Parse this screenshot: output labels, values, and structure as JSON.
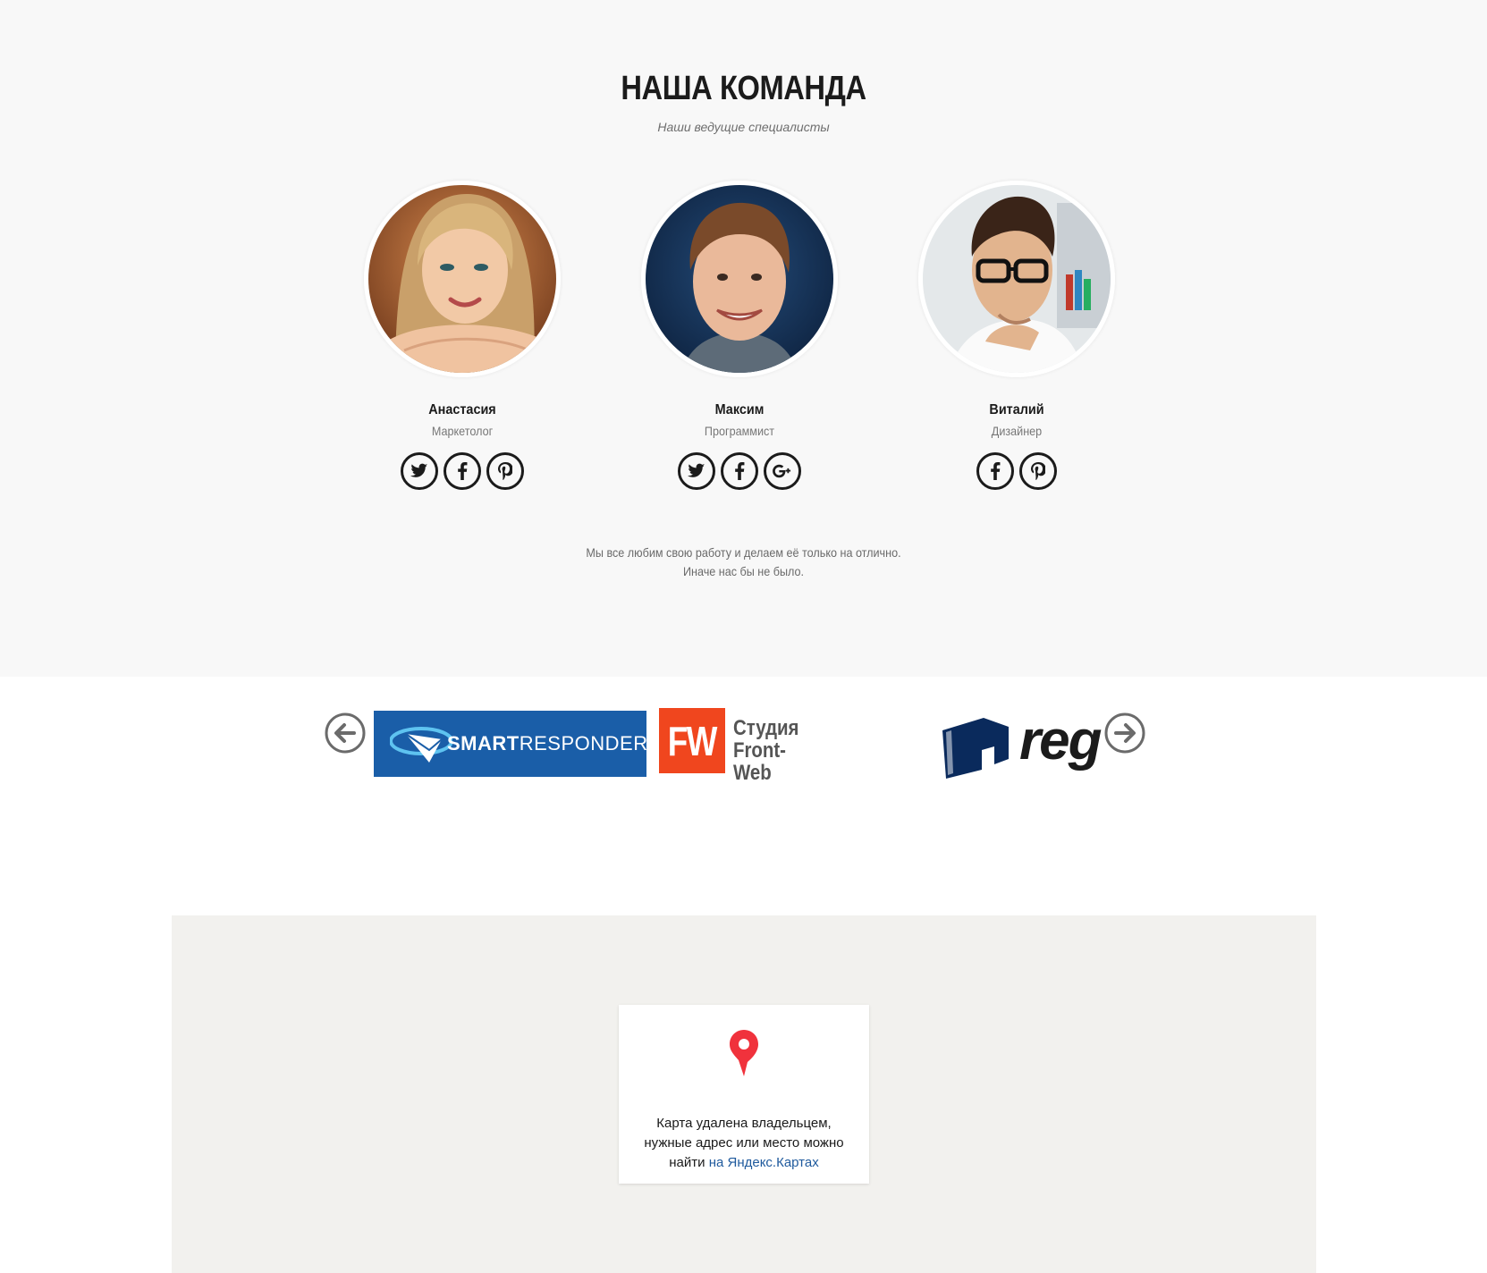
{
  "team": {
    "title": "НАША КОМАНДА",
    "subtitle": "Наши ведущие специалисты",
    "members": [
      {
        "name": "Анастасия",
        "role": "Маркетолог",
        "socials": [
          "twitter-icon",
          "facebook-icon",
          "pinterest-icon"
        ]
      },
      {
        "name": "Максим",
        "role": "Программист",
        "socials": [
          "twitter-icon",
          "facebook-icon",
          "google-plus-icon"
        ]
      },
      {
        "name": "Виталий",
        "role": "Дизайнер",
        "socials": [
          "facebook-icon",
          "pinterest-icon"
        ]
      }
    ],
    "note_line1": "Мы все любим свою работу и делаем её только на отлично.",
    "note_line2": "Иначе нас бы не было."
  },
  "partners": {
    "logos": [
      {
        "name": "smartresponder-logo",
        "text_a": "SMART",
        "text_b": "RESPONDER",
        "color": "#1a5ea8"
      },
      {
        "name": "front-web-logo",
        "mark": "FW",
        "line1": "Студия",
        "line2": "Front-Web",
        "color": "#f0461e"
      },
      {
        "name": "reg-logo",
        "text": "reg",
        "color": "#0a2a5c"
      }
    ]
  },
  "map": {
    "line1": "Карта удалена владельцем,",
    "line2": "нужные адрес или место можно",
    "line3_prefix": "найти ",
    "link": "на Яндекс.Картах",
    "pin_color": "#f0323c"
  }
}
